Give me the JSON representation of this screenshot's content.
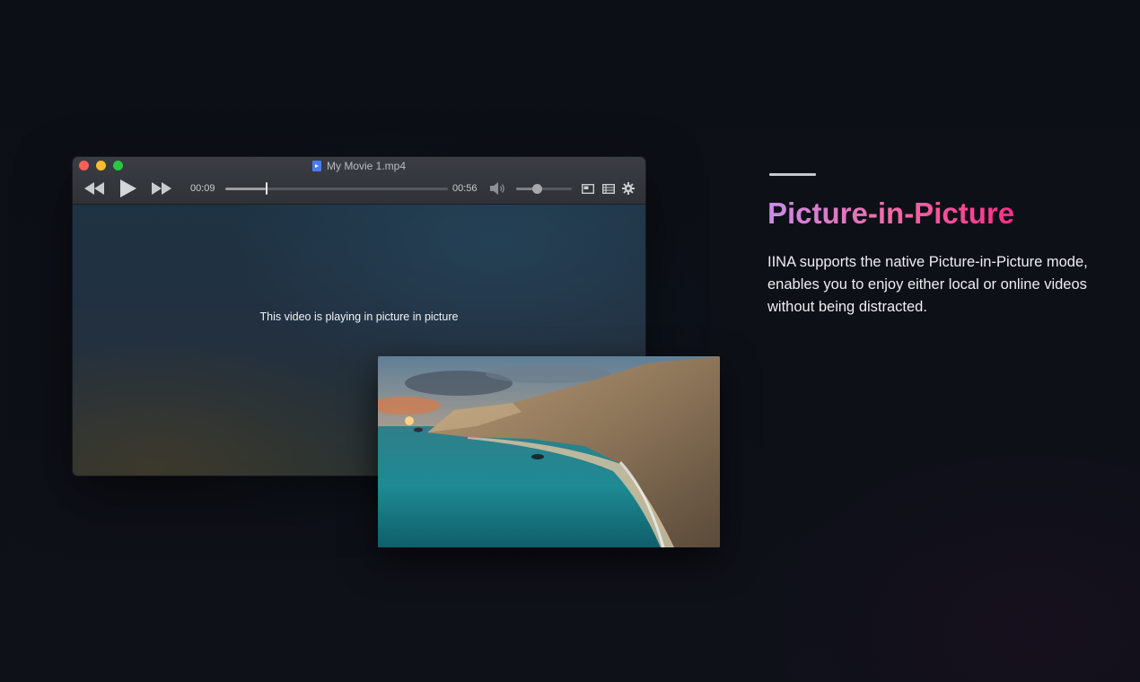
{
  "player": {
    "window_title": "My Movie 1.mp4",
    "current_time": "00:09",
    "duration": "00:56",
    "playback_progress": 0.18,
    "volume_level": 0.37,
    "pip_message": "This video is playing in picture in picture"
  },
  "feature": {
    "headline": "Picture-in-Picture",
    "description": "IINA supports the native Picture-in-Picture mode, enables you to enjoy either local or online videos without being distracted."
  },
  "colors": {
    "headline_gradient_start": "#c98be8",
    "headline_gradient_end": "#ff2e88",
    "close": "#fe5f57",
    "minimize": "#febc2e",
    "maximize": "#28c840"
  }
}
